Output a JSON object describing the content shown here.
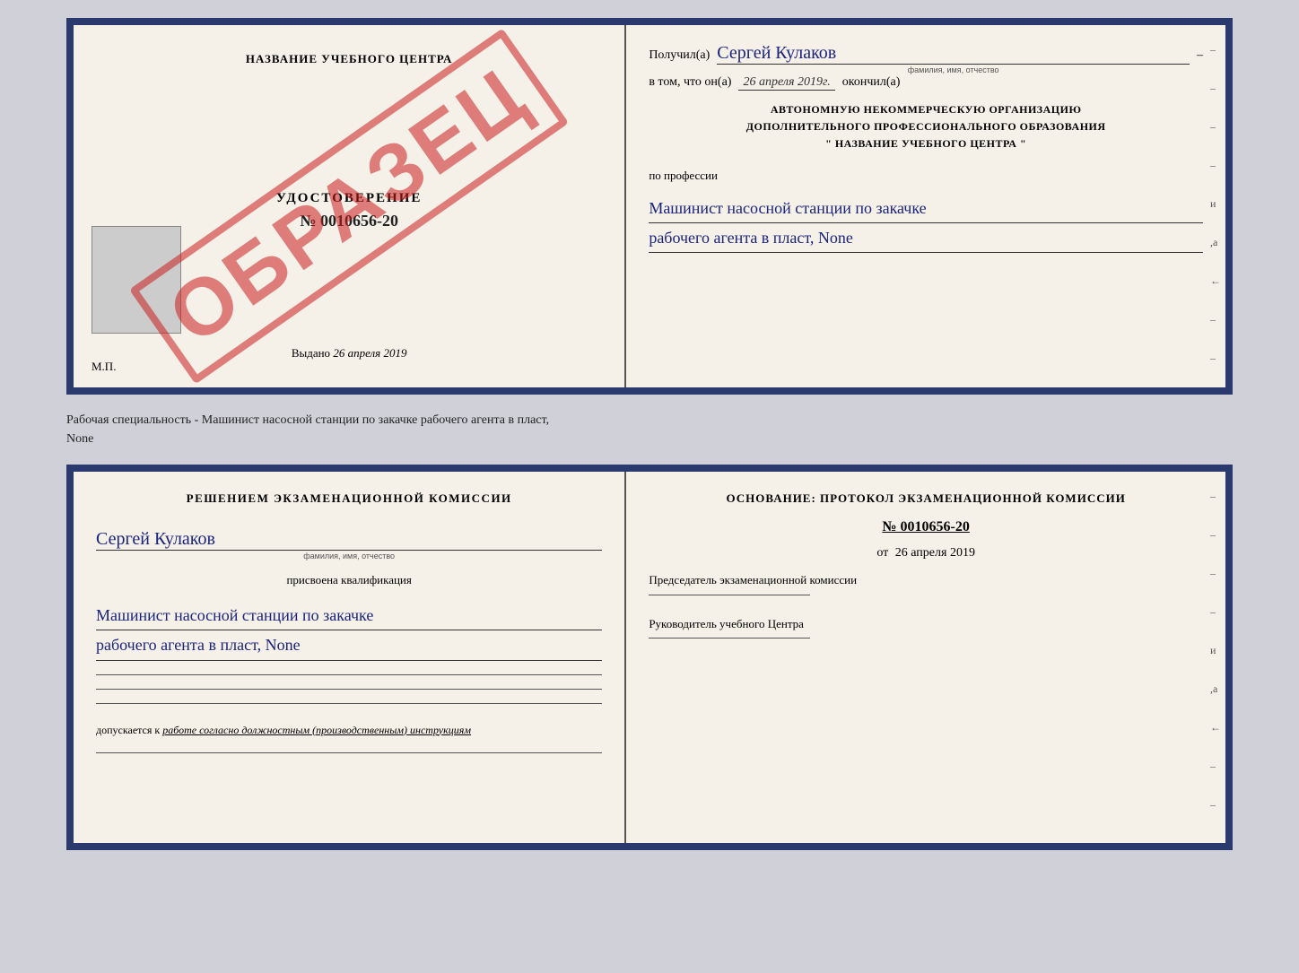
{
  "cert_top": {
    "left": {
      "title": "НАЗВАНИЕ УЧЕБНОГО ЦЕНТРА",
      "udostoverenie_label": "УДОСТОВЕРЕНИЕ",
      "number": "№ 0010656-20",
      "vydano_label": "Выдано",
      "vydano_date": "26 апреля 2019",
      "mp_label": "М.П.",
      "obrazec": "ОБРАЗЕЦ"
    },
    "right": {
      "poluchil_label": "Получил(а)",
      "name": "Сергей Кулаков",
      "name_sublabel": "фамилия, имя, отчество",
      "vtom_label": "в том, что он(а)",
      "vtom_date": "26 апреля 2019г.",
      "okonchil_label": "окончил(а)",
      "org_line1": "АВТОНОМНУЮ НЕКОММЕРЧЕСКУЮ ОРГАНИЗАЦИЮ",
      "org_line2": "ДОПОЛНИТЕЛЬНОГО ПРОФЕССИОНАЛЬНОГО ОБРАЗОВАНИЯ",
      "org_line3": "\"  НАЗВАНИЕ УЧЕБНОГО ЦЕНТРА  \"",
      "po_professii_label": "по профессии",
      "profession_line1": "Машинист насосной станции по закачке",
      "profession_line2": "рабочего агента в пласт, None",
      "side_marks": [
        "-",
        "-",
        "-",
        "-",
        "и",
        ",а",
        "←",
        "-",
        "-",
        "-"
      ]
    }
  },
  "between": {
    "text_line1": "Рабочая специальность - Машинист насосной станции по закачке рабочего агента в пласт,",
    "text_line2": "None"
  },
  "cert_bottom": {
    "left": {
      "resheniem_label": "Решением  экзаменационной  комиссии",
      "name": "Сергей Кулаков",
      "name_sublabel": "фамилия, имя, отчество",
      "prisvoena_label": "присвоена квалификация",
      "qual_line1": "Машинист насосной станции по закачке",
      "qual_line2": "рабочего агента в пласт, None",
      "dopuskaetsya_label": "допускается к",
      "dopuskaetsya_value": "работе согласно должностным (производственным) инструкциям"
    },
    "right": {
      "osnovanie_label": "Основание:  протокол  экзаменационной  комиссии",
      "number": "№  0010656-20",
      "ot_label": "от",
      "ot_date": "26 апреля 2019",
      "predsedatel_label": "Председатель экзаменационной комиссии",
      "rukovoditel_label": "Руководитель учебного Центра",
      "side_marks": [
        "-",
        "-",
        "-",
        "-",
        "и",
        ",а",
        "←",
        "-",
        "-",
        "-"
      ]
    }
  }
}
